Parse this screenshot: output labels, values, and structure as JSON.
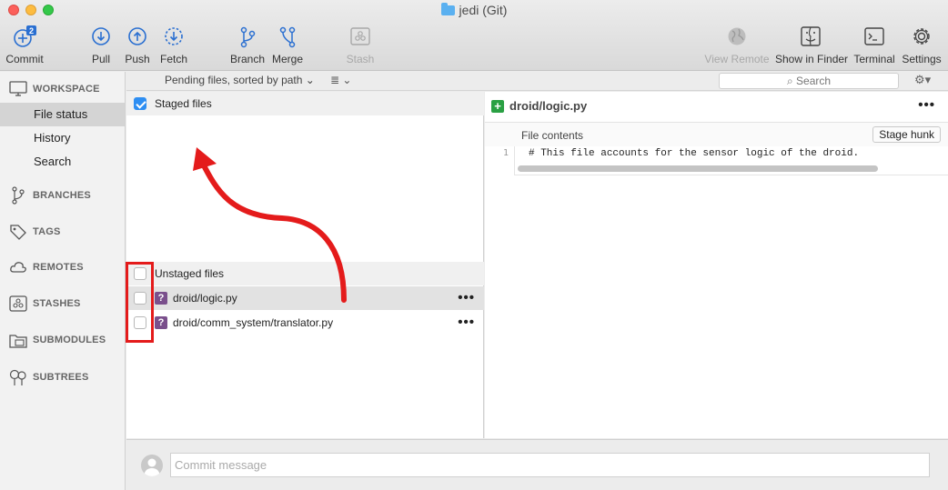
{
  "window": {
    "title": "jedi (Git)"
  },
  "toolbar": {
    "commit": {
      "label": "Commit",
      "badge": "2"
    },
    "pull": "Pull",
    "push": "Push",
    "fetch": "Fetch",
    "branch": "Branch",
    "merge": "Merge",
    "stash": "Stash",
    "view_remote": "View Remote",
    "show_in_finder": "Show in Finder",
    "terminal": "Terminal",
    "settings": "Settings"
  },
  "sidebar": {
    "workspace": "WORKSPACE",
    "workspace_items": [
      "File status",
      "History",
      "Search"
    ],
    "active_item": "File status",
    "sections": [
      "BRANCHES",
      "TAGS",
      "REMOTES",
      "STASHES",
      "SUBMODULES",
      "SUBTREES"
    ]
  },
  "filterbar": {
    "sort": "Pending files, sorted by path",
    "search_placeholder": "Search"
  },
  "staged": {
    "header": "Staged files",
    "checked": true
  },
  "unstaged": {
    "header": "Unstaged files",
    "files": [
      {
        "name": "droid/logic.py",
        "status": "?"
      },
      {
        "name": "droid/comm_system/translator.py",
        "status": "?"
      }
    ]
  },
  "diff": {
    "file": "droid/logic.py",
    "section_label": "File contents",
    "stage_hunk": "Stage hunk",
    "line_number": "1",
    "line": "# This file accounts for the sensor logic of the droid."
  },
  "commit": {
    "placeholder": "Commit message"
  },
  "colors": {
    "annotation": "#e41b1b",
    "accent": "#2e8ef2",
    "untracked": "#7a4f8c",
    "added": "#2aa043"
  }
}
